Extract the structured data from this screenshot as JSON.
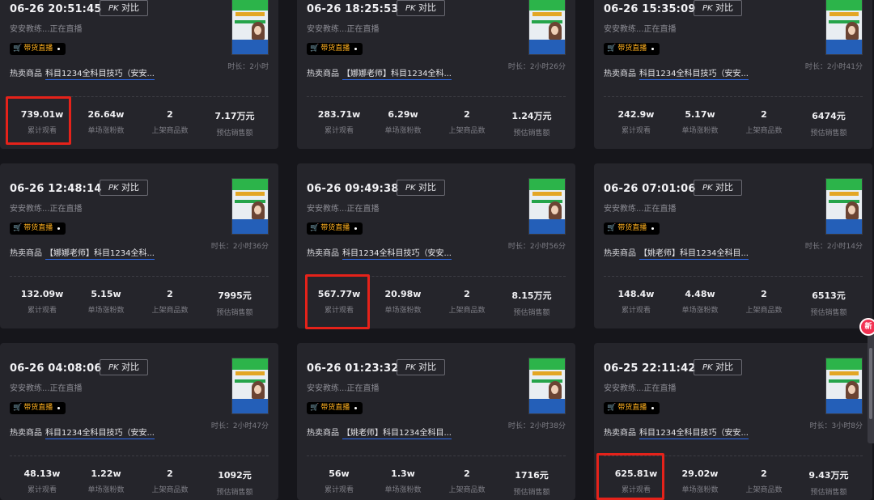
{
  "cards": [
    {
      "datetime": "06-26 20:51:45",
      "pk": "PK",
      "pk_label": "对比",
      "host": "安安教练...正在直播",
      "badge": "带货直播",
      "goods_label": "热卖商品",
      "goods": "科目1234全科目技巧（安安...",
      "duration": "时长：2小时",
      "stats": [
        {
          "value": "739.01w",
          "label": "累计观看"
        },
        {
          "value": "26.64w",
          "label": "单场涨粉数"
        },
        {
          "value": "2",
          "label": "上架商品数"
        },
        {
          "value": "7.17万元",
          "label": "预估销售额"
        }
      ]
    },
    {
      "datetime": "06-26 18:25:53",
      "pk": "PK",
      "pk_label": "对比",
      "host": "安安教练...正在直播",
      "badge": "带货直播",
      "goods_label": "热卖商品",
      "goods": "【娜娜老师】科目1234全科...",
      "duration": "时长：2小时26分",
      "stats": [
        {
          "value": "283.71w",
          "label": "累计观看"
        },
        {
          "value": "6.29w",
          "label": "单场涨粉数"
        },
        {
          "value": "2",
          "label": "上架商品数"
        },
        {
          "value": "1.24万元",
          "label": "预估销售额"
        }
      ]
    },
    {
      "datetime": "06-26 15:35:09",
      "pk": "PK",
      "pk_label": "对比",
      "host": "安安教练...正在直播",
      "badge": "带货直播",
      "goods_label": "热卖商品",
      "goods": "科目1234全科目技巧（安安...",
      "duration": "时长：2小时41分",
      "stats": [
        {
          "value": "242.9w",
          "label": "累计观看"
        },
        {
          "value": "5.17w",
          "label": "单场涨粉数"
        },
        {
          "value": "2",
          "label": "上架商品数"
        },
        {
          "value": "6474元",
          "label": "预估销售额"
        }
      ]
    },
    {
      "datetime": "06-26 12:48:14",
      "pk": "PK",
      "pk_label": "对比",
      "host": "安安教练...正在直播",
      "badge": "带货直播",
      "goods_label": "热卖商品",
      "goods": "【娜娜老师】科目1234全科...",
      "duration": "时长：2小时36分",
      "stats": [
        {
          "value": "132.09w",
          "label": "累计观看"
        },
        {
          "value": "5.15w",
          "label": "单场涨粉数"
        },
        {
          "value": "2",
          "label": "上架商品数"
        },
        {
          "value": "7995元",
          "label": "预估销售额"
        }
      ]
    },
    {
      "datetime": "06-26 09:49:38",
      "pk": "PK",
      "pk_label": "对比",
      "host": "安安教练...正在直播",
      "badge": "带货直播",
      "goods_label": "热卖商品",
      "goods": "科目1234全科目技巧（安安...",
      "duration": "时长：2小时56分",
      "stats": [
        {
          "value": "567.77w",
          "label": "累计观看"
        },
        {
          "value": "20.98w",
          "label": "单场涨粉数"
        },
        {
          "value": "2",
          "label": "上架商品数"
        },
        {
          "value": "8.15万元",
          "label": "预估销售额"
        }
      ]
    },
    {
      "datetime": "06-26 07:01:06",
      "pk": "PK",
      "pk_label": "对比",
      "host": "安安教练...正在直播",
      "badge": "带货直播",
      "goods_label": "热卖商品",
      "goods": "【姚老师】科目1234全科目...",
      "duration": "时长：2小时14分",
      "stats": [
        {
          "value": "148.4w",
          "label": "累计观看"
        },
        {
          "value": "4.48w",
          "label": "单场涨粉数"
        },
        {
          "value": "2",
          "label": "上架商品数"
        },
        {
          "value": "6513元",
          "label": "预估销售额"
        }
      ]
    },
    {
      "datetime": "06-26 04:08:06",
      "pk": "PK",
      "pk_label": "对比",
      "host": "安安教练...正在直播",
      "badge": "带货直播",
      "goods_label": "热卖商品",
      "goods": "科目1234全科目技巧（安安...",
      "duration": "时长：2小时47分",
      "stats": [
        {
          "value": "48.13w",
          "label": "累计观看"
        },
        {
          "value": "1.22w",
          "label": "单场涨粉数"
        },
        {
          "value": "2",
          "label": "上架商品数"
        },
        {
          "value": "1092元",
          "label": "预估销售额"
        }
      ]
    },
    {
      "datetime": "06-26 01:23:32",
      "pk": "PK",
      "pk_label": "对比",
      "host": "安安教练...正在直播",
      "badge": "带货直播",
      "goods_label": "热卖商品",
      "goods": "【姚老师】科目1234全科目...",
      "duration": "时长：2小时38分",
      "stats": [
        {
          "value": "56w",
          "label": "累计观看"
        },
        {
          "value": "1.3w",
          "label": "单场涨粉数"
        },
        {
          "value": "2",
          "label": "上架商品数"
        },
        {
          "value": "1716元",
          "label": "预估销售额"
        }
      ]
    },
    {
      "datetime": "06-25 22:11:42",
      "pk": "PK",
      "pk_label": "对比",
      "host": "安安教练...正在直播",
      "badge": "带货直播",
      "goods_label": "热卖商品",
      "goods": "科目1234全科目技巧（安安...",
      "duration": "时长：3小时8分",
      "stats": [
        {
          "value": "625.81w",
          "label": "累计观看"
        },
        {
          "value": "29.02w",
          "label": "单场涨粉数"
        },
        {
          "value": "2",
          "label": "上架商品数"
        },
        {
          "value": "9.43万元",
          "label": "预估销售额"
        }
      ]
    }
  ],
  "side_badge": "新",
  "colors": {
    "highlight": "#e5221a",
    "badge_text": "#ffb01f",
    "link_underline": "#2f6df0",
    "background": "#16161b",
    "card": "#25252b"
  }
}
